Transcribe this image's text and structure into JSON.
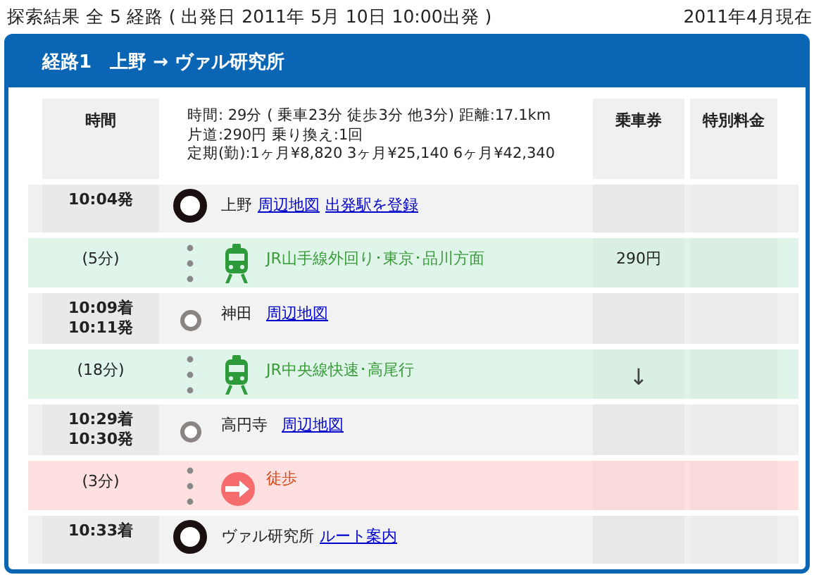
{
  "header": {
    "title": "探索結果 全 5 経路 ( 出発日 2011年 5月 10日 10:00出発 )",
    "as_of": "2011年4月現在"
  },
  "route": {
    "title": "経路1　上野 → ヴァル研究所"
  },
  "summary": {
    "time_heading": "時間",
    "lines": [
      "時間: 29分 ( 乗車23分 徒歩3分 他3分) 距離:17.1km",
      "片道:290円 乗り換え:1回",
      "定期(勤):1ヶ月¥8,820 3ヶ月¥25,140 6ヶ月¥42,340"
    ],
    "ticket_heading": "乗車券",
    "special_heading": "特別料金"
  },
  "rows": [
    {
      "kind": "station",
      "endpoint": true,
      "times": [
        "10:04発"
      ],
      "name": "上野",
      "links": [
        "周辺地図",
        "出発駅を登録"
      ]
    },
    {
      "kind": "train",
      "duration": "(5分)",
      "line": "JR山手線外回り･東京･品川方面",
      "fare": "290円"
    },
    {
      "kind": "station",
      "endpoint": false,
      "times": [
        "10:09着",
        "10:11発"
      ],
      "name": "神田",
      "links": [
        "周辺地図"
      ]
    },
    {
      "kind": "train",
      "duration": "(18分)",
      "line": "JR中央線快速･高尾行",
      "fare": "↓"
    },
    {
      "kind": "station",
      "endpoint": false,
      "times": [
        "10:29着",
        "10:30発"
      ],
      "name": "高円寺",
      "links": [
        "周辺地図"
      ]
    },
    {
      "kind": "walk",
      "duration": "(3分)",
      "line": "徒歩"
    },
    {
      "kind": "station",
      "endpoint": true,
      "times": [
        "10:33着"
      ],
      "name": "ヴァル研究所",
      "links": [
        "ルート案内"
      ]
    }
  ]
}
